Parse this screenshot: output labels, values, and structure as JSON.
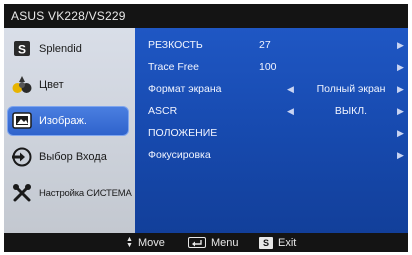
{
  "title": "ASUS VK228/VS229",
  "sidebar": {
    "items": [
      {
        "label": "Splendid",
        "icon": "splendid-s-icon"
      },
      {
        "label": "Цвет",
        "icon": "color-palette-icon"
      },
      {
        "label": "Изображ.",
        "icon": "image-icon",
        "active": true
      },
      {
        "label": "Выбор Входа",
        "icon": "input-select-icon"
      },
      {
        "label": "Настройка СИСТЕМА",
        "icon": "system-setup-icon"
      }
    ]
  },
  "settings": {
    "rows": [
      {
        "name": "РЕЗКОСТЬ",
        "value": "27"
      },
      {
        "name": "Trace Free",
        "value": "100"
      },
      {
        "name": "Формат экрана",
        "value": "Полный экран"
      },
      {
        "name": "ASCR",
        "value": "ВЫКЛ."
      },
      {
        "name": "ПОЛОЖЕНИЕ"
      },
      {
        "name": "Фокусировка"
      }
    ]
  },
  "bottom": {
    "move": "Move",
    "menu": "Menu",
    "exit_key": "S",
    "exit": "Exit"
  },
  "colors": {
    "accent": "#2f63cc",
    "panel": "#174aaf",
    "bar": "#141414"
  }
}
